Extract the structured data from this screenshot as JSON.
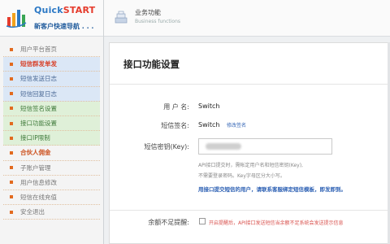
{
  "brand": {
    "title_a": "Quick",
    "title_b": "START",
    "subtitle": "新客户快速导航 . . ."
  },
  "header": {
    "title": "业务功能",
    "subtitle": "Business functions"
  },
  "sidebar": {
    "items": [
      {
        "label": "用户平台首页",
        "style": ""
      },
      {
        "label": "短信群发单发",
        "style": "blue active"
      },
      {
        "label": "短信发送日志",
        "style": "blue"
      },
      {
        "label": "短信回复日志",
        "style": "blue"
      },
      {
        "label": "短信签名设置",
        "style": "green"
      },
      {
        "label": "接口功能设置",
        "style": "green"
      },
      {
        "label": "接口IP限制",
        "style": "green"
      },
      {
        "label": "合伙人佣金",
        "style": "orange"
      },
      {
        "label": "子账户管理",
        "style": ""
      },
      {
        "label": "用户信息修改",
        "style": ""
      },
      {
        "label": "短信在线充值",
        "style": ""
      },
      {
        "label": "安全退出",
        "style": ""
      }
    ]
  },
  "main": {
    "title": "接口功能设置",
    "username_label": "用 户 名:",
    "username_value": "Switch",
    "signature_label": "短信签名:",
    "signature_value": "Switch",
    "signature_link": "修改签名",
    "key_label": "短信密钥(Key):",
    "hint1": "API接口提交时，需帐定用户名和短信密钥(Key),",
    "hint2": "不需要登录密码。Key字母区分大小写。",
    "hint3": "用接口提交短信的用户，请联系客服绑定短信模板，即发即到。",
    "balance_label": "余额不足提醒:",
    "balance_warn": "开启提醒后，API接口发送短信当余额不足系统会发送提示信息"
  }
}
